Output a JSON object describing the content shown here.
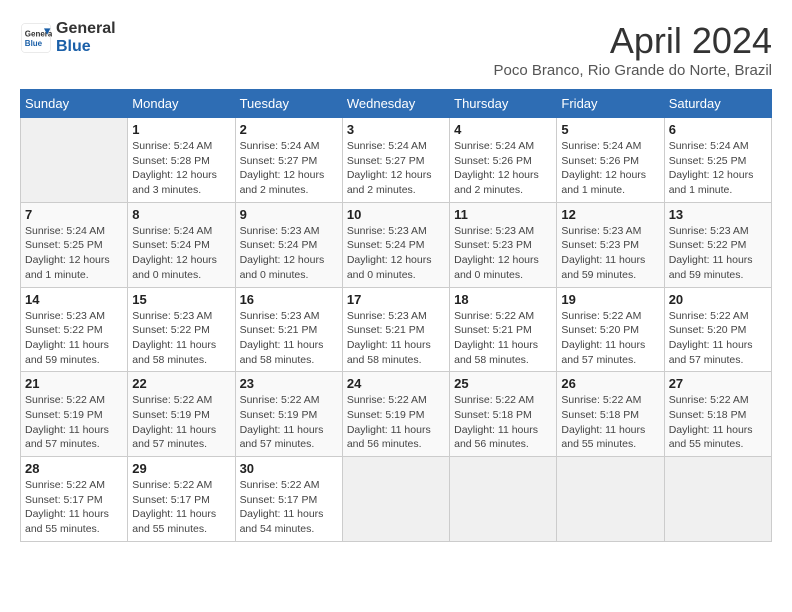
{
  "header": {
    "logo_line1": "General",
    "logo_line2": "Blue",
    "month": "April 2024",
    "location": "Poco Branco, Rio Grande do Norte, Brazil"
  },
  "weekdays": [
    "Sunday",
    "Monday",
    "Tuesday",
    "Wednesday",
    "Thursday",
    "Friday",
    "Saturday"
  ],
  "weeks": [
    [
      {
        "day": "",
        "info": ""
      },
      {
        "day": "1",
        "info": "Sunrise: 5:24 AM\nSunset: 5:28 PM\nDaylight: 12 hours\nand 3 minutes."
      },
      {
        "day": "2",
        "info": "Sunrise: 5:24 AM\nSunset: 5:27 PM\nDaylight: 12 hours\nand 2 minutes."
      },
      {
        "day": "3",
        "info": "Sunrise: 5:24 AM\nSunset: 5:27 PM\nDaylight: 12 hours\nand 2 minutes."
      },
      {
        "day": "4",
        "info": "Sunrise: 5:24 AM\nSunset: 5:26 PM\nDaylight: 12 hours\nand 2 minutes."
      },
      {
        "day": "5",
        "info": "Sunrise: 5:24 AM\nSunset: 5:26 PM\nDaylight: 12 hours\nand 1 minute."
      },
      {
        "day": "6",
        "info": "Sunrise: 5:24 AM\nSunset: 5:25 PM\nDaylight: 12 hours\nand 1 minute."
      }
    ],
    [
      {
        "day": "7",
        "info": "Sunrise: 5:24 AM\nSunset: 5:25 PM\nDaylight: 12 hours\nand 1 minute."
      },
      {
        "day": "8",
        "info": "Sunrise: 5:24 AM\nSunset: 5:24 PM\nDaylight: 12 hours\nand 0 minutes."
      },
      {
        "day": "9",
        "info": "Sunrise: 5:23 AM\nSunset: 5:24 PM\nDaylight: 12 hours\nand 0 minutes."
      },
      {
        "day": "10",
        "info": "Sunrise: 5:23 AM\nSunset: 5:24 PM\nDaylight: 12 hours\nand 0 minutes."
      },
      {
        "day": "11",
        "info": "Sunrise: 5:23 AM\nSunset: 5:23 PM\nDaylight: 12 hours\nand 0 minutes."
      },
      {
        "day": "12",
        "info": "Sunrise: 5:23 AM\nSunset: 5:23 PM\nDaylight: 11 hours\nand 59 minutes."
      },
      {
        "day": "13",
        "info": "Sunrise: 5:23 AM\nSunset: 5:22 PM\nDaylight: 11 hours\nand 59 minutes."
      }
    ],
    [
      {
        "day": "14",
        "info": "Sunrise: 5:23 AM\nSunset: 5:22 PM\nDaylight: 11 hours\nand 59 minutes."
      },
      {
        "day": "15",
        "info": "Sunrise: 5:23 AM\nSunset: 5:22 PM\nDaylight: 11 hours\nand 58 minutes."
      },
      {
        "day": "16",
        "info": "Sunrise: 5:23 AM\nSunset: 5:21 PM\nDaylight: 11 hours\nand 58 minutes."
      },
      {
        "day": "17",
        "info": "Sunrise: 5:23 AM\nSunset: 5:21 PM\nDaylight: 11 hours\nand 58 minutes."
      },
      {
        "day": "18",
        "info": "Sunrise: 5:22 AM\nSunset: 5:21 PM\nDaylight: 11 hours\nand 58 minutes."
      },
      {
        "day": "19",
        "info": "Sunrise: 5:22 AM\nSunset: 5:20 PM\nDaylight: 11 hours\nand 57 minutes."
      },
      {
        "day": "20",
        "info": "Sunrise: 5:22 AM\nSunset: 5:20 PM\nDaylight: 11 hours\nand 57 minutes."
      }
    ],
    [
      {
        "day": "21",
        "info": "Sunrise: 5:22 AM\nSunset: 5:19 PM\nDaylight: 11 hours\nand 57 minutes."
      },
      {
        "day": "22",
        "info": "Sunrise: 5:22 AM\nSunset: 5:19 PM\nDaylight: 11 hours\nand 57 minutes."
      },
      {
        "day": "23",
        "info": "Sunrise: 5:22 AM\nSunset: 5:19 PM\nDaylight: 11 hours\nand 57 minutes."
      },
      {
        "day": "24",
        "info": "Sunrise: 5:22 AM\nSunset: 5:19 PM\nDaylight: 11 hours\nand 56 minutes."
      },
      {
        "day": "25",
        "info": "Sunrise: 5:22 AM\nSunset: 5:18 PM\nDaylight: 11 hours\nand 56 minutes."
      },
      {
        "day": "26",
        "info": "Sunrise: 5:22 AM\nSunset: 5:18 PM\nDaylight: 11 hours\nand 55 minutes."
      },
      {
        "day": "27",
        "info": "Sunrise: 5:22 AM\nSunset: 5:18 PM\nDaylight: 11 hours\nand 55 minutes."
      }
    ],
    [
      {
        "day": "28",
        "info": "Sunrise: 5:22 AM\nSunset: 5:17 PM\nDaylight: 11 hours\nand 55 minutes."
      },
      {
        "day": "29",
        "info": "Sunrise: 5:22 AM\nSunset: 5:17 PM\nDaylight: 11 hours\nand 55 minutes."
      },
      {
        "day": "30",
        "info": "Sunrise: 5:22 AM\nSunset: 5:17 PM\nDaylight: 11 hours\nand 54 minutes."
      },
      {
        "day": "",
        "info": ""
      },
      {
        "day": "",
        "info": ""
      },
      {
        "day": "",
        "info": ""
      },
      {
        "day": "",
        "info": ""
      }
    ]
  ]
}
